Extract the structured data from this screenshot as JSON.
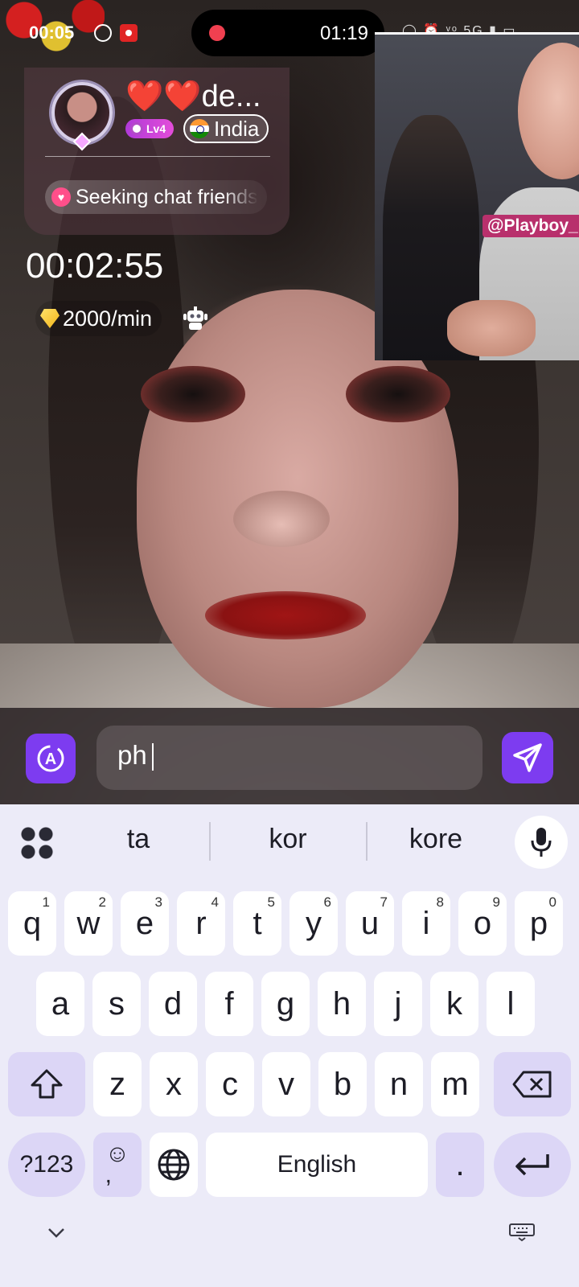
{
  "status_bar": {
    "time_left": "00:05",
    "island_time": "01:19",
    "system_icons": "◯ ⏰ ᵛᵒ 5G ▮ ▭"
  },
  "profile": {
    "name": "❤️❤️de...",
    "level": "Lv4",
    "country": "India",
    "status_text": "Seeking chat friends"
  },
  "call": {
    "timer": "00:02:55",
    "rate": "2000/min"
  },
  "pip": {
    "tag": "@Playboy_"
  },
  "chat": {
    "input_value": "ph"
  },
  "keyboard": {
    "suggestions": [
      "ta",
      "kor",
      "kore"
    ],
    "row1": [
      {
        "k": "q",
        "h": "1"
      },
      {
        "k": "w",
        "h": "2"
      },
      {
        "k": "e",
        "h": "3"
      },
      {
        "k": "r",
        "h": "4"
      },
      {
        "k": "t",
        "h": "5"
      },
      {
        "k": "y",
        "h": "6"
      },
      {
        "k": "u",
        "h": "7"
      },
      {
        "k": "i",
        "h": "8"
      },
      {
        "k": "o",
        "h": "9"
      },
      {
        "k": "p",
        "h": "0"
      }
    ],
    "row2": [
      "a",
      "s",
      "d",
      "f",
      "g",
      "h",
      "j",
      "k",
      "l"
    ],
    "row3": [
      "z",
      "x",
      "c",
      "v",
      "b",
      "n",
      "m"
    ],
    "symbols_label": "?123",
    "emoji_label": "☺\n,",
    "space_label": "English",
    "period_label": "."
  },
  "colors": {
    "accent": "#7d3cf0",
    "keyboard_bg": "#ecebf8",
    "function_key": "#dcd6f6",
    "tag_bg": "#b8306c"
  }
}
